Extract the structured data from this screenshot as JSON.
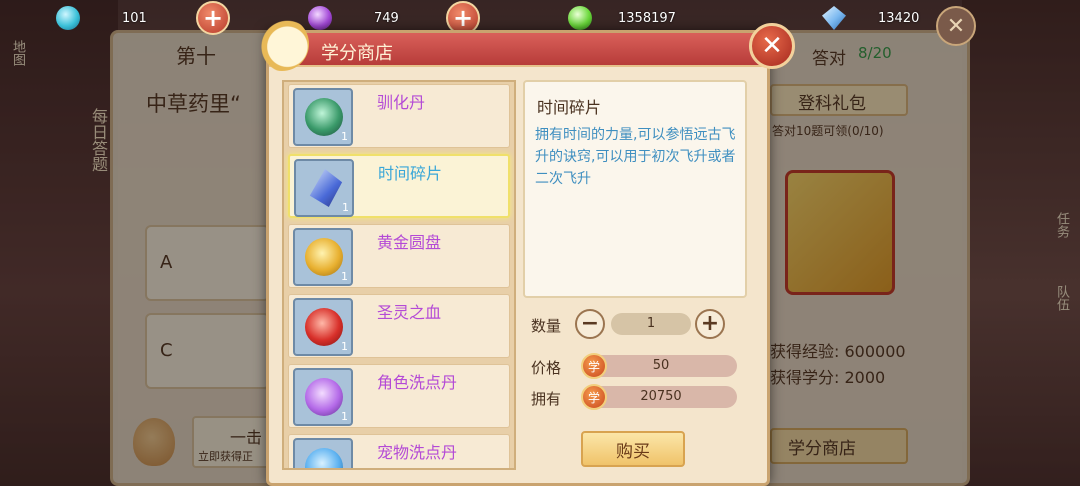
{
  "resources": [
    {
      "icon": "blue-orb-icon",
      "value": "101",
      "color": "#3ac0d8"
    },
    {
      "icon": "purple-orb-icon",
      "value": "749",
      "color": "#a44ad8"
    },
    {
      "icon": "green-orb-icon",
      "value": "1358197",
      "color": "#6ad83a"
    },
    {
      "icon": "diamond-icon",
      "value": "13420",
      "color": "#7ab8f0"
    }
  ],
  "background": {
    "title_fragment": "第十",
    "question_fragment": "中草药里“",
    "answered_label": "答对",
    "answered_count": "8/20",
    "daily_quiz_tab": "每日答题",
    "left_tab_fragment": "地图",
    "option_a": "A",
    "option_c": "C",
    "gift_button": "登科礼包",
    "gift_note": "答对10题可领(0/10)",
    "exp_label": "获得经验: 600000",
    "credit_label": "获得学分: 2000",
    "shop_button": "学分商店",
    "one_click": "一击",
    "one_click_sub": "立即获得正",
    "right_tab_task": "任务",
    "right_tab_team": "队伍"
  },
  "shop": {
    "title": "学分商店",
    "items": [
      {
        "name": "驯化丹",
        "count": "1",
        "orb_color": "#3a9a6a"
      },
      {
        "name": "时间碎片",
        "count": "1",
        "orb_color": "#4a6ad8",
        "selected": true
      },
      {
        "name": "黄金圆盘",
        "count": "1",
        "orb_color": "#e8b030"
      },
      {
        "name": "圣灵之血",
        "count": "1",
        "orb_color": "#d8302a"
      },
      {
        "name": "角色洗点丹",
        "count": "1",
        "orb_color": "#b46ae8"
      },
      {
        "name": "宠物洗点丹",
        "count": "",
        "orb_color": "#5ab0f0"
      }
    ],
    "detail_title": "时间碎片",
    "detail_desc": "拥有时间的力量,可以参悟远古飞升的诀窍,可以用于初次飞升或者二次飞升",
    "quantity_label": "数量",
    "quantity_value": "1",
    "price_label": "价格",
    "price_value": "50",
    "owned_label": "拥有",
    "owned_value": "20750",
    "coin_glyph": "学",
    "buy_label": "购买"
  }
}
